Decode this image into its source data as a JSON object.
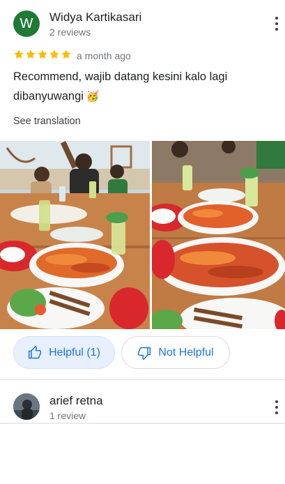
{
  "review1": {
    "avatar_letter": "W",
    "author": "Widya Kartikasari",
    "review_count": "2 reviews",
    "rating": 5,
    "time": "a month ago",
    "text": "Recommend, wajib datang kesini kalo lagi dibanyuwangi",
    "emoji": "🥳",
    "see_translation": "See translation",
    "helpful_label": "Helpful (1)",
    "not_helpful_label": "Not Helpful",
    "colors": {
      "avatar_bg": "#1e7a35",
      "star": "#fbbc04",
      "accent": "#1a73e8"
    }
  },
  "review2": {
    "author": "arief retna",
    "review_count": "1 review"
  }
}
